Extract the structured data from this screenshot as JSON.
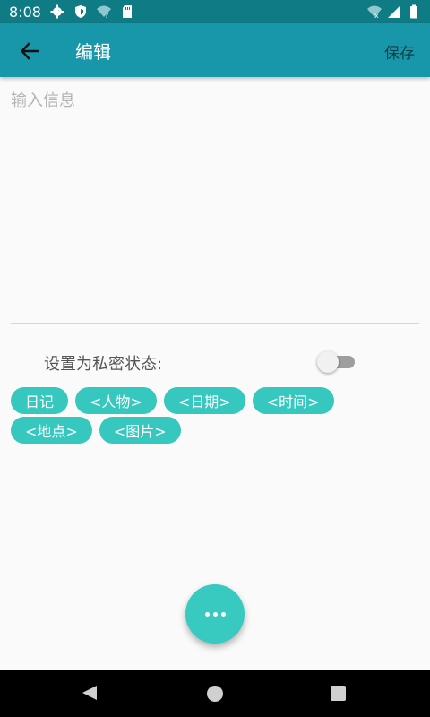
{
  "status_bar": {
    "time": "8:08",
    "icons": [
      "gear-icon",
      "shield-icon",
      "wifi-question-icon",
      "sd-card-icon",
      "wifi-off-icon",
      "signal-icon",
      "battery-icon"
    ]
  },
  "app_bar": {
    "title": "编辑",
    "save_label": "保存",
    "back_icon": "arrow-left-icon"
  },
  "editor": {
    "placeholder": "输入信息",
    "value": ""
  },
  "private_setting": {
    "label": "设置为私密状态:",
    "enabled": false
  },
  "tags": [
    "日记",
    "<人物>",
    "<日期>",
    "<时间>",
    "<地点>",
    "<图片>"
  ],
  "fab": {
    "icon": "more-dots-icon"
  },
  "colors": {
    "status_bar": "#0f7b84",
    "app_bar": "#1897aa",
    "chip": "#36c7be",
    "fab": "#38c9c0"
  }
}
